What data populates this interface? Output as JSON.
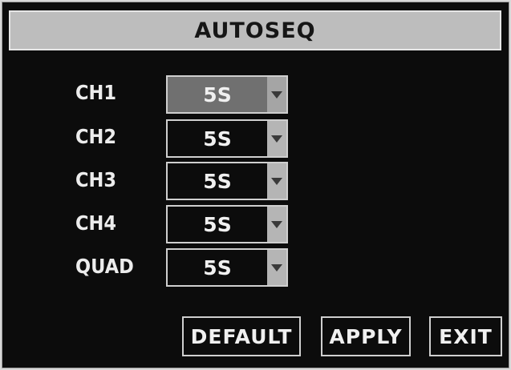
{
  "window": {
    "title": "AUTOSEQ"
  },
  "channels": [
    {
      "label": "CH1",
      "value": "5S",
      "focused": true
    },
    {
      "label": "CH2",
      "value": "5S",
      "focused": false
    },
    {
      "label": "CH3",
      "value": "5S",
      "focused": false
    },
    {
      "label": "CH4",
      "value": "5S",
      "focused": false
    },
    {
      "label": "QUAD",
      "value": "5S",
      "focused": false
    }
  ],
  "icons": {
    "dropdown": "chevron-down-icon"
  },
  "buttons": {
    "default": "DEFAULT",
    "apply": "APPLY",
    "exit": "EXIT"
  },
  "colors": {
    "background": "#0c0c0c",
    "title_bar": "#bdbdbd",
    "focus": "#707070",
    "text": "#f0f0f0"
  }
}
